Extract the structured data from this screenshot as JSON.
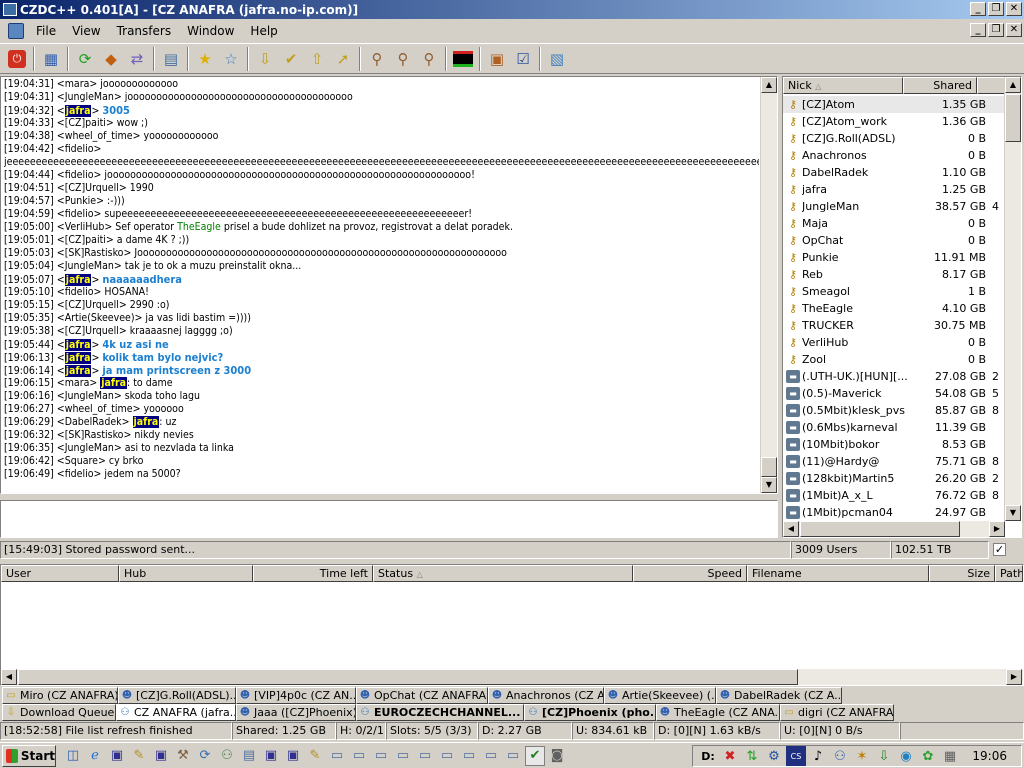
{
  "window": {
    "title": "CZDC++ 0.401[A] - [CZ ANAFRA (jafra.no-ip.com)]"
  },
  "menu": [
    "File",
    "View",
    "Transfers",
    "Window",
    "Help"
  ],
  "toolbar_icons": [
    "power-icon",
    "network-icon",
    "refresh-icon",
    "compass-icon",
    "reconnect-icon",
    "notepad-icon",
    "favorites-icon",
    "favorite-users-icon",
    "download-queue-icon",
    "finished-downloads-icon",
    "upload-queue-icon",
    "finished-uploads-icon",
    "search-icon",
    "adl-search-icon",
    "search-spy-icon",
    "network-stats-icon",
    "open-file-list-icon",
    "settings-icon",
    "notepad2-icon"
  ],
  "chat": [
    {
      "t": "[19:04:31]",
      "u": "<mara>",
      "m": " jooooooooooooo"
    },
    {
      "t": "[19:04:31]",
      "u": "<JungleMan>",
      "m": " jooooooooooooooooooooooooooooooooooooooo"
    },
    {
      "t": "[19:04:32]",
      "me": "jafra",
      "m": "3005"
    },
    {
      "t": "[19:04:33]",
      "u": "<[CZ]paiti>",
      "m": " wow ;)"
    },
    {
      "t": "[19:04:38]",
      "u": "<wheel_of_time>",
      "m": " yoooooooooooo"
    },
    {
      "t": "[19:04:42]",
      "u": "<fidelio>",
      "m": ""
    },
    {
      "t": "",
      "u": "",
      "m": "jeeeeeeeeeeeeeeeeeeeeeeeeeeeeeeeeeeeeeeeeeeeeeeeeeeeeeeeeeeeeeeeeeeeeeeeeeeeeeeeeeeeeeeeeeeeeeeeeeeeeeeeeeeeeeeeeeeeeeeeeeeeeeeeeeeeeeeeeeeeeeeeeeeeeeeeeeeeeeeeeeee"
    },
    {
      "t": "[19:04:44]",
      "u": "<fidelio>",
      "m": " jooooooooooooooooooooooooooooooooooooooooooooooooooooooooooooooo!"
    },
    {
      "t": "[19:04:51]",
      "u": "<[CZ]Urquell>",
      "m": " 1990"
    },
    {
      "t": "[19:04:57]",
      "u": "<Punkie>",
      "m": " :-)))"
    },
    {
      "t": "[19:04:59]",
      "u": "<fidelio>",
      "m": " supeeeeeeeeeeeeeeeeeeeeeeeeeeeeeeeeeeeeeeeeeeeeeeeeeeeeeeeeeeer!"
    },
    {
      "t": "[19:05:00]",
      "u": "<VerliHub>",
      "m": " Sef operator ",
      "g": "TheEagle",
      "m2": " prisel a bude dohlizet na provoz, registrovat a delat poradek."
    },
    {
      "t": "[19:05:01]",
      "u": "<[CZ]paiti>",
      "m": " a dame 4K ? ;))"
    },
    {
      "t": "[19:05:03]",
      "u": "<[SK]Rastisko>",
      "m": " Joooooooooooooooooooooooooooooooooooooooooooooooooooooooooooooooo"
    },
    {
      "t": "[19:05:04]",
      "u": "<JungleMan>",
      "m": " tak je to ok a muzu preinstalit okna..."
    },
    {
      "t": "[19:05:07]",
      "me": "jafra",
      "m": "naaaaaadhera"
    },
    {
      "t": "[19:05:10]",
      "u": "<fidelio>",
      "m": " HOSANA!"
    },
    {
      "t": "[19:05:15]",
      "u": "<[CZ]Urquell>",
      "m": " 2990 :o)"
    },
    {
      "t": "[19:05:35]",
      "u": "<Artie(Skeevee)>",
      "m": " ja vas lidi bastim =))))"
    },
    {
      "t": "[19:05:38]",
      "u": "<[CZ]Urquell>",
      "m": " kraaaasnej lagggg ;o)"
    },
    {
      "t": "[19:05:44]",
      "me": "jafra",
      "m": "4k uz asi ne"
    },
    {
      "t": "[19:06:13]",
      "me": "jafra",
      "m": "kolik tam bylo nejvic?"
    },
    {
      "t": "[19:06:14]",
      "me": "jafra",
      "m": "ja mam printscreen z 3000"
    },
    {
      "t": "[19:06:15]",
      "u": "<mara>",
      "hl": "jafra",
      "m": ": to dame"
    },
    {
      "t": "[19:06:16]",
      "u": "<JungleMan>",
      "m": " skoda toho lagu"
    },
    {
      "t": "[19:06:27]",
      "u": "<wheel_of_time>",
      "m": " yoooooo"
    },
    {
      "t": "[19:06:29]",
      "u": "<DabelRadek>",
      "hl": "jafra",
      "m": ": uz"
    },
    {
      "t": "[19:06:32]",
      "u": "<[SK]Rastisko>",
      "m": " nikdy nevies"
    },
    {
      "t": "[19:06:35]",
      "u": "<JungleMan>",
      "m": " asi to nezvlada ta linka"
    },
    {
      "t": "[19:06:42]",
      "u": "<Square>",
      "m": " cy brko"
    },
    {
      "t": "[19:06:49]",
      "u": "<fidelio>",
      "m": " jedem na 5000?"
    }
  ],
  "users": {
    "headers": {
      "nick": "Nick",
      "shared": "Shared"
    },
    "rows": [
      {
        "nick": "[CZ]Atom",
        "shared": "1.35 GB",
        "icon": "key",
        "extra": ""
      },
      {
        "nick": "[CZ]Atom_work",
        "shared": "1.36 GB",
        "icon": "key",
        "extra": ""
      },
      {
        "nick": "[CZ]G.Roll(ADSL)",
        "shared": "0 B",
        "icon": "key",
        "extra": ""
      },
      {
        "nick": "Anachronos",
        "shared": "0 B",
        "icon": "key",
        "extra": ""
      },
      {
        "nick": "DabelRadek",
        "shared": "1.10 GB",
        "icon": "key",
        "extra": ""
      },
      {
        "nick": "jafra",
        "shared": "1.25 GB",
        "icon": "key",
        "extra": ""
      },
      {
        "nick": "JungleMan",
        "shared": "38.57 GB",
        "icon": "key",
        "extra": "4"
      },
      {
        "nick": "Maja",
        "shared": "0 B",
        "icon": "key",
        "extra": ""
      },
      {
        "nick": "OpChat",
        "shared": "0 B",
        "icon": "key",
        "extra": ""
      },
      {
        "nick": "Punkie",
        "shared": "11.91 MB",
        "icon": "key",
        "extra": ""
      },
      {
        "nick": "Reb",
        "shared": "8.17 GB",
        "icon": "key",
        "extra": ""
      },
      {
        "nick": "Smeagol",
        "shared": "1 B",
        "icon": "key",
        "extra": ""
      },
      {
        "nick": "TheEagle",
        "shared": "4.10 GB",
        "icon": "key",
        "extra": ""
      },
      {
        "nick": "TRUCKER",
        "shared": "30.75 MB",
        "icon": "key",
        "extra": ""
      },
      {
        "nick": "VerliHub",
        "shared": "0 B",
        "icon": "key",
        "extra": ""
      },
      {
        "nick": "Zool",
        "shared": "0 B",
        "icon": "key",
        "extra": ""
      },
      {
        "nick": "(.UTH-UK.)[HUN][...",
        "shared": "27.08 GB",
        "icon": "srv",
        "extra": "2"
      },
      {
        "nick": "(0.5)-Maverick",
        "shared": "54.08 GB",
        "icon": "srv",
        "extra": "5"
      },
      {
        "nick": "(0.5Mbit)klesk_pvs",
        "shared": "85.87 GB",
        "icon": "srv",
        "extra": "8"
      },
      {
        "nick": "(0.6Mbs)karneval",
        "shared": "11.39 GB",
        "icon": "srv",
        "extra": ""
      },
      {
        "nick": "(10Mbit)bokor",
        "shared": "8.53 GB",
        "icon": "srv",
        "extra": ""
      },
      {
        "nick": "(11)@Hardy@",
        "shared": "75.71 GB",
        "icon": "srv",
        "extra": "8"
      },
      {
        "nick": "(128kbit)Martin5",
        "shared": "26.20 GB",
        "icon": "srv",
        "extra": "2"
      },
      {
        "nick": "(1Mbit)A_x_L",
        "shared": "76.72 GB",
        "icon": "srv",
        "extra": "8"
      },
      {
        "nick": "(1Mbit)pcman04",
        "shared": "24.97 GB",
        "icon": "srv",
        "extra": ""
      }
    ]
  },
  "status_chat": {
    "message": "[15:49:03] Stored password sent...",
    "users": "3009 Users",
    "shared": "102.51 TB",
    "check": "✓"
  },
  "queue_headers": [
    "User",
    "Hub",
    "Time left",
    "Status",
    "Speed",
    "Filename",
    "Size",
    "Path"
  ],
  "tabs_row1": [
    {
      "label": "Miro (CZ ANAFRA)",
      "icon": "folder-icon"
    },
    {
      "label": "[CZ]G.Roll(ADSL)...",
      "icon": "user-icon"
    },
    {
      "label": "[VIP]4p0c (CZ AN...",
      "icon": "user-icon"
    },
    {
      "label": "OpChat (CZ ANAFRA)",
      "icon": "user-icon"
    },
    {
      "label": "Anachronos (CZ A...",
      "icon": "user-icon"
    },
    {
      "label": "Artie(Skeevee) (...",
      "icon": "user-icon"
    },
    {
      "label": "DabelRadek (CZ A...",
      "icon": "user-icon"
    }
  ],
  "tabs_row2": [
    {
      "label": "Download Queue",
      "icon": "queue-icon",
      "state": ""
    },
    {
      "label": "CZ ANAFRA (jafra...",
      "icon": "hub-icon",
      "state": "active"
    },
    {
      "label": "Jaaa ([CZ]Phoenix)",
      "icon": "user-icon",
      "state": ""
    },
    {
      "label": "EUROCZECHCHANNEL...",
      "icon": "hub-icon",
      "state": "bold"
    },
    {
      "label": "[CZ]Phoenix (pho...",
      "icon": "hub-icon",
      "state": "bold"
    },
    {
      "label": "TheEagle (CZ ANA...",
      "icon": "user-icon",
      "state": ""
    },
    {
      "label": "digri (CZ ANAFRA)",
      "icon": "folder-icon",
      "state": ""
    }
  ],
  "status_main": {
    "message": "[18:52:58] File list refresh finished",
    "shared": "Shared: 1.25 GB",
    "hubs": "H: 0/2/1",
    "slots": "Slots: 5/5 (3/3)",
    "downloaded": "D: 2.27 GB",
    "uploaded": "U: 834.61 kB",
    "down_speed": "D: [0][N] 1.63 kB/s",
    "up_speed": "U: [0][N] 0 B/s"
  },
  "taskbar": {
    "start": "Start",
    "clock": "19:06"
  }
}
